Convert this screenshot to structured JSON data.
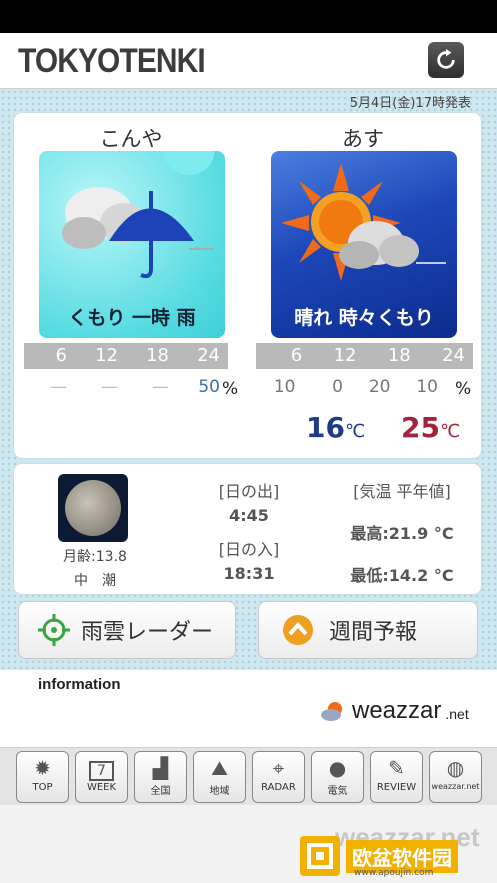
{
  "header": {
    "title": "TOKYOTENKI",
    "refresh_icon": "refresh-icon"
  },
  "issued_at": "5月4日(金)17時発表",
  "today": {
    "label": "こんや",
    "weather": "くもり 一時 雨",
    "hours": [
      "6",
      "12",
      "18",
      "24"
    ],
    "precip": [
      "—",
      "—",
      "—",
      "50"
    ],
    "precip_unit": "%"
  },
  "tomorrow": {
    "label": "あす",
    "weather": "晴れ 時々くもり",
    "hours": [
      "6",
      "12",
      "18",
      "24"
    ],
    "precip": [
      "10",
      "0",
      "20",
      "10"
    ],
    "precip_unit": "%",
    "temp_min": "16",
    "temp_max": "25",
    "temp_unit": "℃"
  },
  "almanac": {
    "moon_age": "月齢:13.8",
    "tide": "中　潮",
    "sunrise_label": "[日の出]",
    "sunrise": "4:45",
    "sunset_label": "[日の入]",
    "sunset": "18:31",
    "normal_label": "[気温 平年値]",
    "normal_high": "最高:21.9 °C",
    "normal_low": "最低:14.2 °C"
  },
  "buttons": {
    "radar": "雨雲レーダー",
    "week": "週間予報"
  },
  "info": {
    "heading": "information",
    "brand": "weazzar",
    "brand_suffix": ".net"
  },
  "tabs": [
    {
      "label": "TOP",
      "icon": "sun-icon"
    },
    {
      "label": "WEEK",
      "icon": "calendar-icon",
      "badge": "7"
    },
    {
      "label": "全国",
      "icon": "bar-icon"
    },
    {
      "label": "地域",
      "icon": "map-icon"
    },
    {
      "label": "RADAR",
      "icon": "crosshair-icon"
    },
    {
      "label": "電気",
      "icon": "bulb-icon"
    },
    {
      "label": "REVIEW",
      "icon": "pencil-icon"
    },
    {
      "label": "weazzar.net",
      "icon": "globe-icon"
    }
  ],
  "footer": {
    "brand": "weazzar.net",
    "watermark": "欧盆软件园",
    "watermark_url": "www.apoujin.com"
  }
}
